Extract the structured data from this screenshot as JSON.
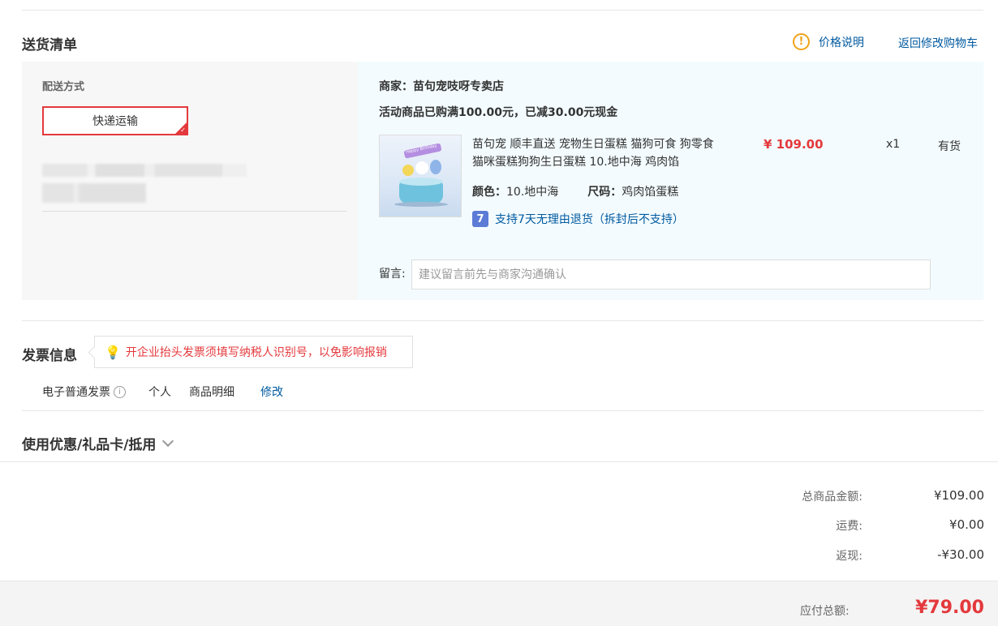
{
  "delivery": {
    "title": "送货清单",
    "price_note": "价格说明",
    "back_to_cart": "返回修改购物车",
    "method_label": "配送方式",
    "method_option": "快递运输"
  },
  "merchant": {
    "label": "商家：苗句宠吱呀专卖店",
    "promo": "活动商品已购满100.00元，已减30.00元现金"
  },
  "product": {
    "name": "苗句宠 顺丰直送 宠物生日蛋糕 猫狗可食 狗零食猫咪蛋糕狗狗生日蛋糕 10.地中海 鸡肉馅",
    "color_label": "颜色：",
    "color_value": "10.地中海",
    "size_label": "尺码：",
    "size_value": "鸡肉馅蛋糕",
    "return_badge": "7",
    "return_policy": "支持7天无理由退货（拆封后不支持）",
    "price": "¥ 109.00",
    "qty": "x1",
    "stock": "有货",
    "image_text": "Happy Birthday"
  },
  "message": {
    "label": "留言:",
    "placeholder": "建议留言前先与商家沟通确认"
  },
  "invoice": {
    "title": "发票信息",
    "tip": "开企业抬头发票须填写纳税人识别号，以免影响报销",
    "type": "电子普通发票",
    "holder": "个人",
    "content": "商品明细",
    "edit": "修改"
  },
  "coupon": {
    "title": "使用优惠/礼品卡/抵用"
  },
  "summary": {
    "goods_label": "总商品金额:",
    "goods_value": "¥109.00",
    "shipping_label": "运费:",
    "shipping_value": "¥0.00",
    "cashback_label": "返现:",
    "cashback_value": "-¥30.00",
    "total_label": "应付总额:",
    "total_value": "¥79.00"
  },
  "colors": {
    "accent_red": "#e4393c",
    "link_blue": "#005aa0",
    "warn_orange": "#f0a21a"
  },
  "icons": [
    "warning-icon",
    "check-corner-icon",
    "seven-day-return-icon",
    "bulb-icon",
    "info-icon",
    "chevron-down-icon"
  ]
}
